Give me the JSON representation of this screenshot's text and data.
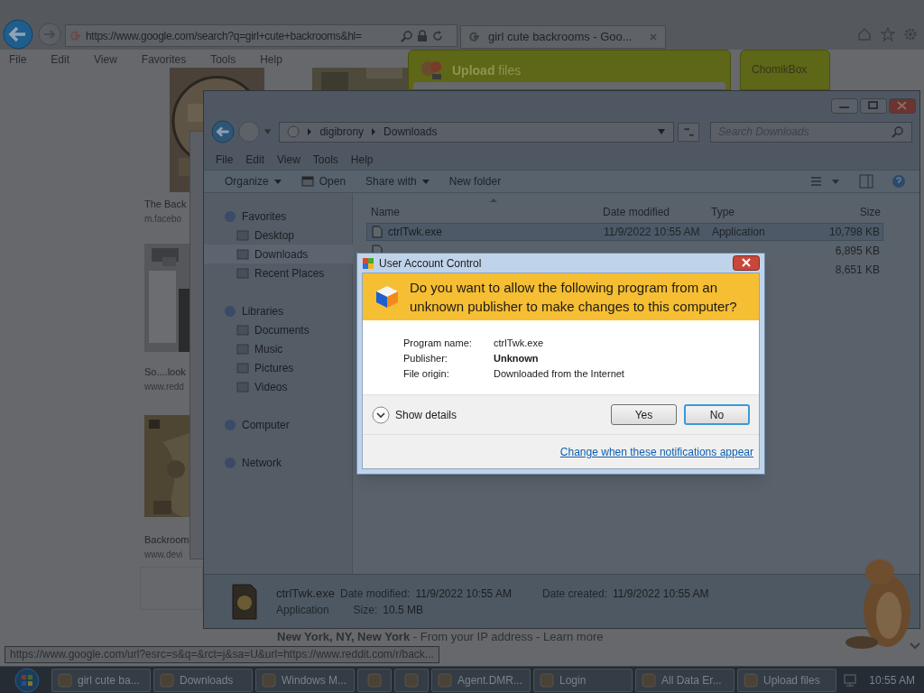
{
  "browser": {
    "address": "https://www.google.com/search?q=girl+cute+backrooms&hl=",
    "tab": "girl cute backrooms - Goo...",
    "menu": [
      "File",
      "Edit",
      "View",
      "Favorites",
      "Tools",
      "Help"
    ],
    "upload_popup": "**Upload** files",
    "chomikbox": "ChomikBox",
    "results": [
      {
        "title": "The Back",
        "url": "m.facebo"
      },
      {
        "title": "So....look",
        "url": "www.redd"
      },
      {
        "title": "Backroom",
        "url": "www.devi"
      }
    ],
    "location_line": "**New York, NY, New York** - From your IP address - Learn more",
    "status_url": "https://www.google.com/url?esrc=s&q=&rct=j&sa=U&url=https://www.reddit.com/r/back..."
  },
  "explorer": {
    "breadcrumb": [
      "digibrony",
      "Downloads"
    ],
    "search_placeholder": "Search Downloads",
    "menu": [
      "File",
      "Edit",
      "View",
      "Tools",
      "Help"
    ],
    "toolbar": [
      {
        "label": "Organize",
        "kind": "dropdown"
      },
      {
        "label": "Open",
        "kind": "icon"
      },
      {
        "label": "Share with",
        "kind": "dropdown"
      },
      {
        "label": "New folder",
        "kind": "plain"
      }
    ],
    "nav": [
      {
        "label": "Favorites",
        "selected": false,
        "children": [
          {
            "label": "Desktop",
            "selected": false
          },
          {
            "label": "Downloads",
            "selected": true
          },
          {
            "label": "Recent Places",
            "selected": false
          }
        ]
      },
      {
        "label": "Libraries",
        "selected": false,
        "children": [
          {
            "label": "Documents",
            "selected": false
          },
          {
            "label": "Music",
            "selected": false
          },
          {
            "label": "Pictures",
            "selected": false
          },
          {
            "label": "Videos",
            "selected": false
          }
        ]
      },
      {
        "label": "Computer",
        "selected": false
      },
      {
        "label": "Network",
        "selected": false
      }
    ],
    "columns": [
      "Name",
      "Date modified",
      "Type",
      "Size"
    ],
    "rows": [
      {
        "name": "ctrlTwk.exe",
        "date": "11/9/2022 10:55 AM",
        "type": "Application",
        "size": "10,798 KB",
        "selected": true,
        "kind": "file"
      },
      {
        "kind": "file",
        "size": "6,895 KB",
        "selected": false
      },
      {
        "kind": "covered",
        "size": "8,651 KB",
        "selected": false
      }
    ],
    "details": {
      "name": "ctrlTwk.exe",
      "kind": "Application",
      "fields": [
        {
          "label": "Date modified:",
          "value": "11/9/2022 10:55 AM"
        },
        {
          "label": "Size:",
          "value": "10.5 MB"
        },
        {
          "label": "Date created:",
          "value": "11/9/2022 10:55 AM"
        }
      ]
    }
  },
  "uac": {
    "title": "User Account Control",
    "question": "Do you want to allow the following program from an unknown publisher to make changes to this computer?",
    "fields": [
      {
        "label": "Program name:",
        "value": "ctrlTwk.exe",
        "bold": false
      },
      {
        "label": "Publisher:",
        "value": "Unknown",
        "bold": true
      },
      {
        "label": "File origin:",
        "value": "Downloaded from the Internet",
        "bold": false
      }
    ],
    "details_toggle": "Show details",
    "buttons": [
      {
        "label": "Yes",
        "default": false
      },
      {
        "label": "No",
        "default": true
      }
    ],
    "link": "Change when these notifications appear"
  },
  "taskbar": {
    "items": [
      {
        "kind": "labeled",
        "label": "girl cute ba..."
      },
      {
        "kind": "labeled",
        "label": "Downloads"
      },
      {
        "kind": "labeled",
        "label": "Windows M..."
      },
      {
        "kind": "icon"
      },
      {
        "kind": "icon"
      },
      {
        "kind": "labeled",
        "label": "Agent.DMR..."
      },
      {
        "kind": "labeled",
        "label": "Login"
      },
      {
        "kind": "labeled",
        "label": "All Data Er..."
      },
      {
        "kind": "labeled",
        "label": "Upload files"
      }
    ],
    "clock": "10:55 AM"
  }
}
